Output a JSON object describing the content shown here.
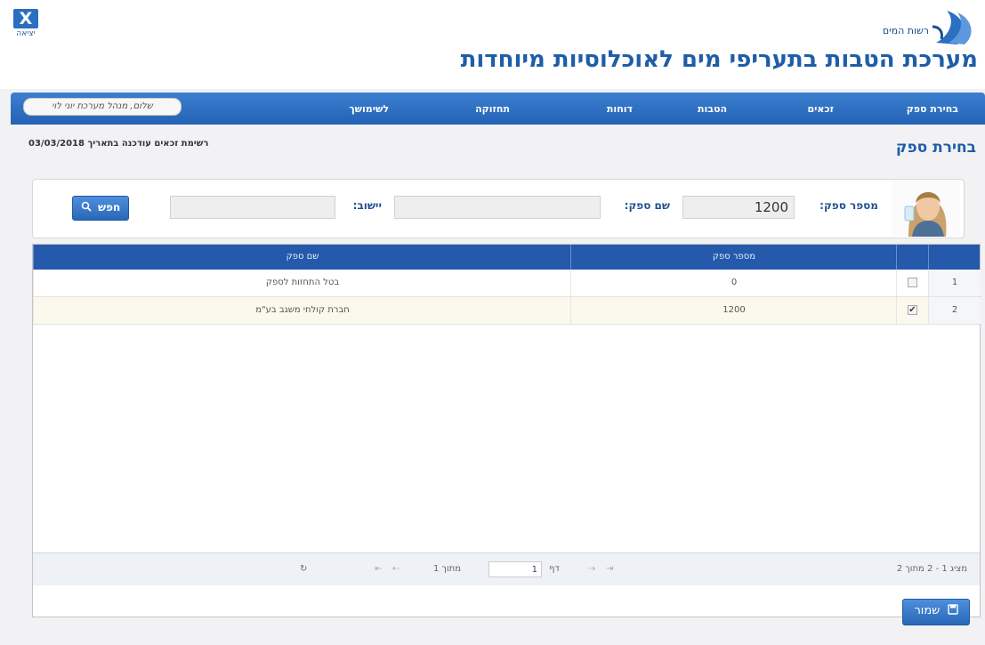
{
  "header": {
    "exit_symbol": "X",
    "exit_label": "יציאה",
    "logo_text": "רשות המים",
    "main_title": "מערכת הטבות בתעריפי מים לאוכלוסיות מיוחדות"
  },
  "nav": {
    "items": [
      "בחירת ספק",
      "זכאים",
      "הטבות",
      "דוחות",
      "תחזוקה",
      "לשימושך"
    ],
    "greeting": "שלום, מנהל מערכת יוני לוי"
  },
  "page": {
    "heading": "בחירת ספק",
    "update_note": "רשימת זכאים עודכנה בתאריך 03/03/2018"
  },
  "search": {
    "supplier_number_label": "מספר ספק:",
    "supplier_number_value": "1200",
    "supplier_name_label": "שם ספק:",
    "supplier_name_value": "",
    "settlement_label": "יישוב:",
    "settlement_value": "",
    "search_button": "חפש"
  },
  "grid": {
    "columns": [
      "מספר ספק",
      "שם ספק"
    ],
    "rows": [
      {
        "index": "1",
        "checked": false,
        "supplier_number": "0",
        "supplier_name": "בטל התחזות לספק"
      },
      {
        "index": "2",
        "checked": true,
        "supplier_number": "1200",
        "supplier_name": "חברת קולחי משגב בע\"מ"
      }
    ]
  },
  "pager": {
    "summary": "מציג 1 - 2 מתוך 2",
    "page_label": "דף",
    "page_value": "1",
    "of_label": "מתוך 1"
  },
  "actions": {
    "save_label": "שמור"
  },
  "colors": {
    "brand_blue": "#1f5da8",
    "nav_blue": "#2a67b8",
    "grid_header": "#2459ab"
  }
}
